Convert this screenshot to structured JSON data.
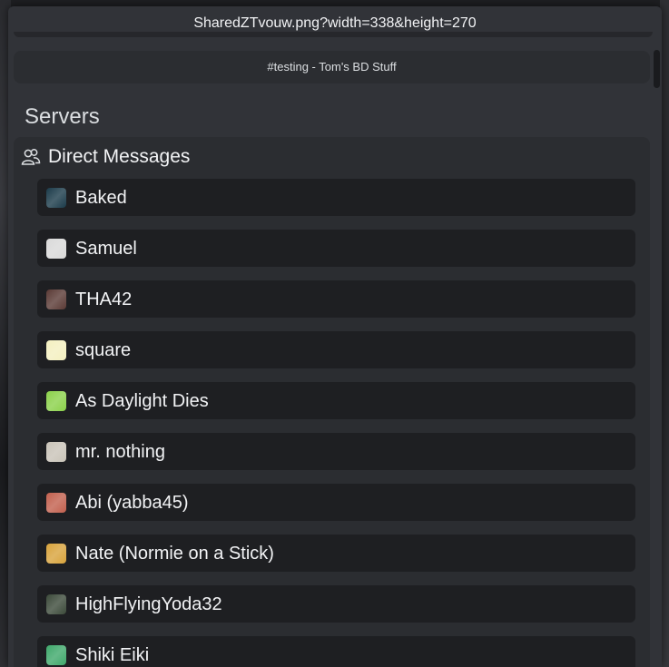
{
  "modal": {
    "title": "SharedZTvouw.png?width=338&height=270"
  },
  "channel": {
    "label": "#testing - Tom's BD Stuff"
  },
  "section": {
    "heading": "Servers"
  },
  "dm": {
    "header_icon": "users-icon",
    "header_label": "Direct Messages",
    "items": [
      {
        "name": "Baked",
        "avatar_color": "#1b3b4a"
      },
      {
        "name": "Samuel",
        "avatar_color": "#d9d9d9"
      },
      {
        "name": "THA42",
        "avatar_color": "#5a3a35"
      },
      {
        "name": "square",
        "avatar_color": "#f4f0c0"
      },
      {
        "name": "As Daylight Dies",
        "avatar_color": "#8bd14a"
      },
      {
        "name": "mr. nothing",
        "avatar_color": "#c9c3b8"
      },
      {
        "name": "Abi (yabba45)",
        "avatar_color": "#c2604e"
      },
      {
        "name": "Nate (Normie on a Stick)",
        "avatar_color": "#d8a33c"
      },
      {
        "name": "HighFlyingYoda32",
        "avatar_color": "#3c4a3a"
      },
      {
        "name": "Shiki Eiki",
        "avatar_color": "#3fa86b"
      }
    ]
  }
}
